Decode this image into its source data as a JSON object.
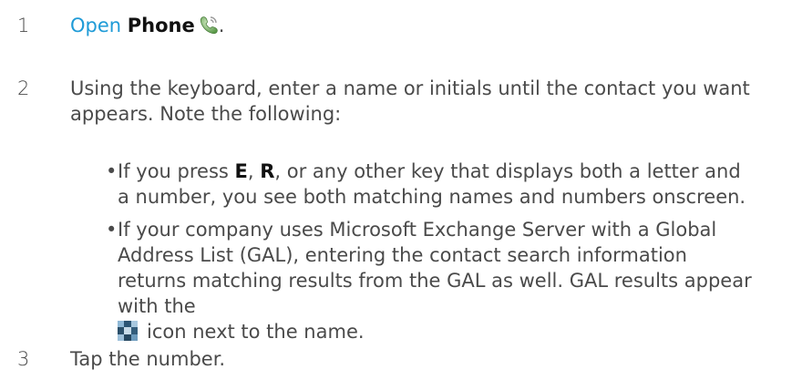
{
  "steps": [
    {
      "number": "1",
      "link_text": "Open",
      "app_name": "Phone",
      "app_icon": "phone-app-icon",
      "trailing": "."
    },
    {
      "number": "2",
      "text": "Using the keyboard, enter a name or initials until the contact you want appears. Note the following:",
      "bullets": [
        {
          "prefix": "If you press ",
          "key1": "E",
          "sep": ", ",
          "key2": "R",
          "rest": ", or any other key that displays both a letter and a number, you see both matching names and numbers onscreen."
        },
        {
          "text": "If your company uses Microsoft Exchange Server with a Global Address List (GAL), entering the contact search information returns matching results from the GAL as well. GAL results appear with the",
          "icon": "gal-contact-icon",
          "suffix": "icon next to the name."
        }
      ]
    },
    {
      "number": "3",
      "text": "Tap the number."
    }
  ],
  "colors": {
    "link": "#1f9bd7",
    "body_text": "#4a4a4a",
    "bold_text": "#111111"
  },
  "bullet_glyph": "•"
}
